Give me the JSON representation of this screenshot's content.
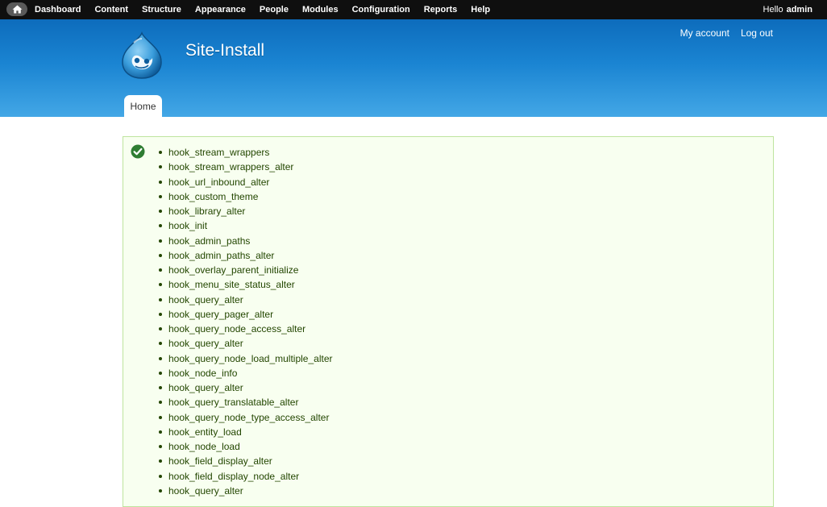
{
  "toolbar": {
    "home_icon": "home-icon",
    "items": [
      "Dashboard",
      "Content",
      "Structure",
      "Appearance",
      "People",
      "Modules",
      "Configuration",
      "Reports",
      "Help"
    ],
    "hello_text": "Hello",
    "username": "admin"
  },
  "header": {
    "site_name": "Site-Install",
    "logo_icon": "drupal-drop-icon",
    "secondary_menu": [
      "My account",
      "Log out"
    ],
    "tabs": [
      {
        "label": "Home"
      }
    ]
  },
  "message": {
    "status_icon": "check-icon",
    "status_color": "#2e7d32",
    "items": [
      "hook_stream_wrappers",
      "hook_stream_wrappers_alter",
      "hook_url_inbound_alter",
      "hook_custom_theme",
      "hook_library_alter",
      "hook_init",
      "hook_admin_paths",
      "hook_admin_paths_alter",
      "hook_overlay_parent_initialize",
      "hook_menu_site_status_alter",
      "hook_query_alter",
      "hook_query_pager_alter",
      "hook_query_node_access_alter",
      "hook_query_alter",
      "hook_query_node_load_multiple_alter",
      "hook_node_info",
      "hook_query_alter",
      "hook_query_translatable_alter",
      "hook_query_node_type_access_alter",
      "hook_entity_load",
      "hook_node_load",
      "hook_field_display_alter",
      "hook_field_display_node_alter",
      "hook_query_alter"
    ]
  },
  "colors": {
    "toolbar_bg": "#0f0f0f",
    "header_top": "#0d6cbc",
    "header_bottom": "#43a7e6",
    "message_bg": "#f8fff0",
    "message_border": "#bee49e",
    "message_text": "#234600"
  }
}
